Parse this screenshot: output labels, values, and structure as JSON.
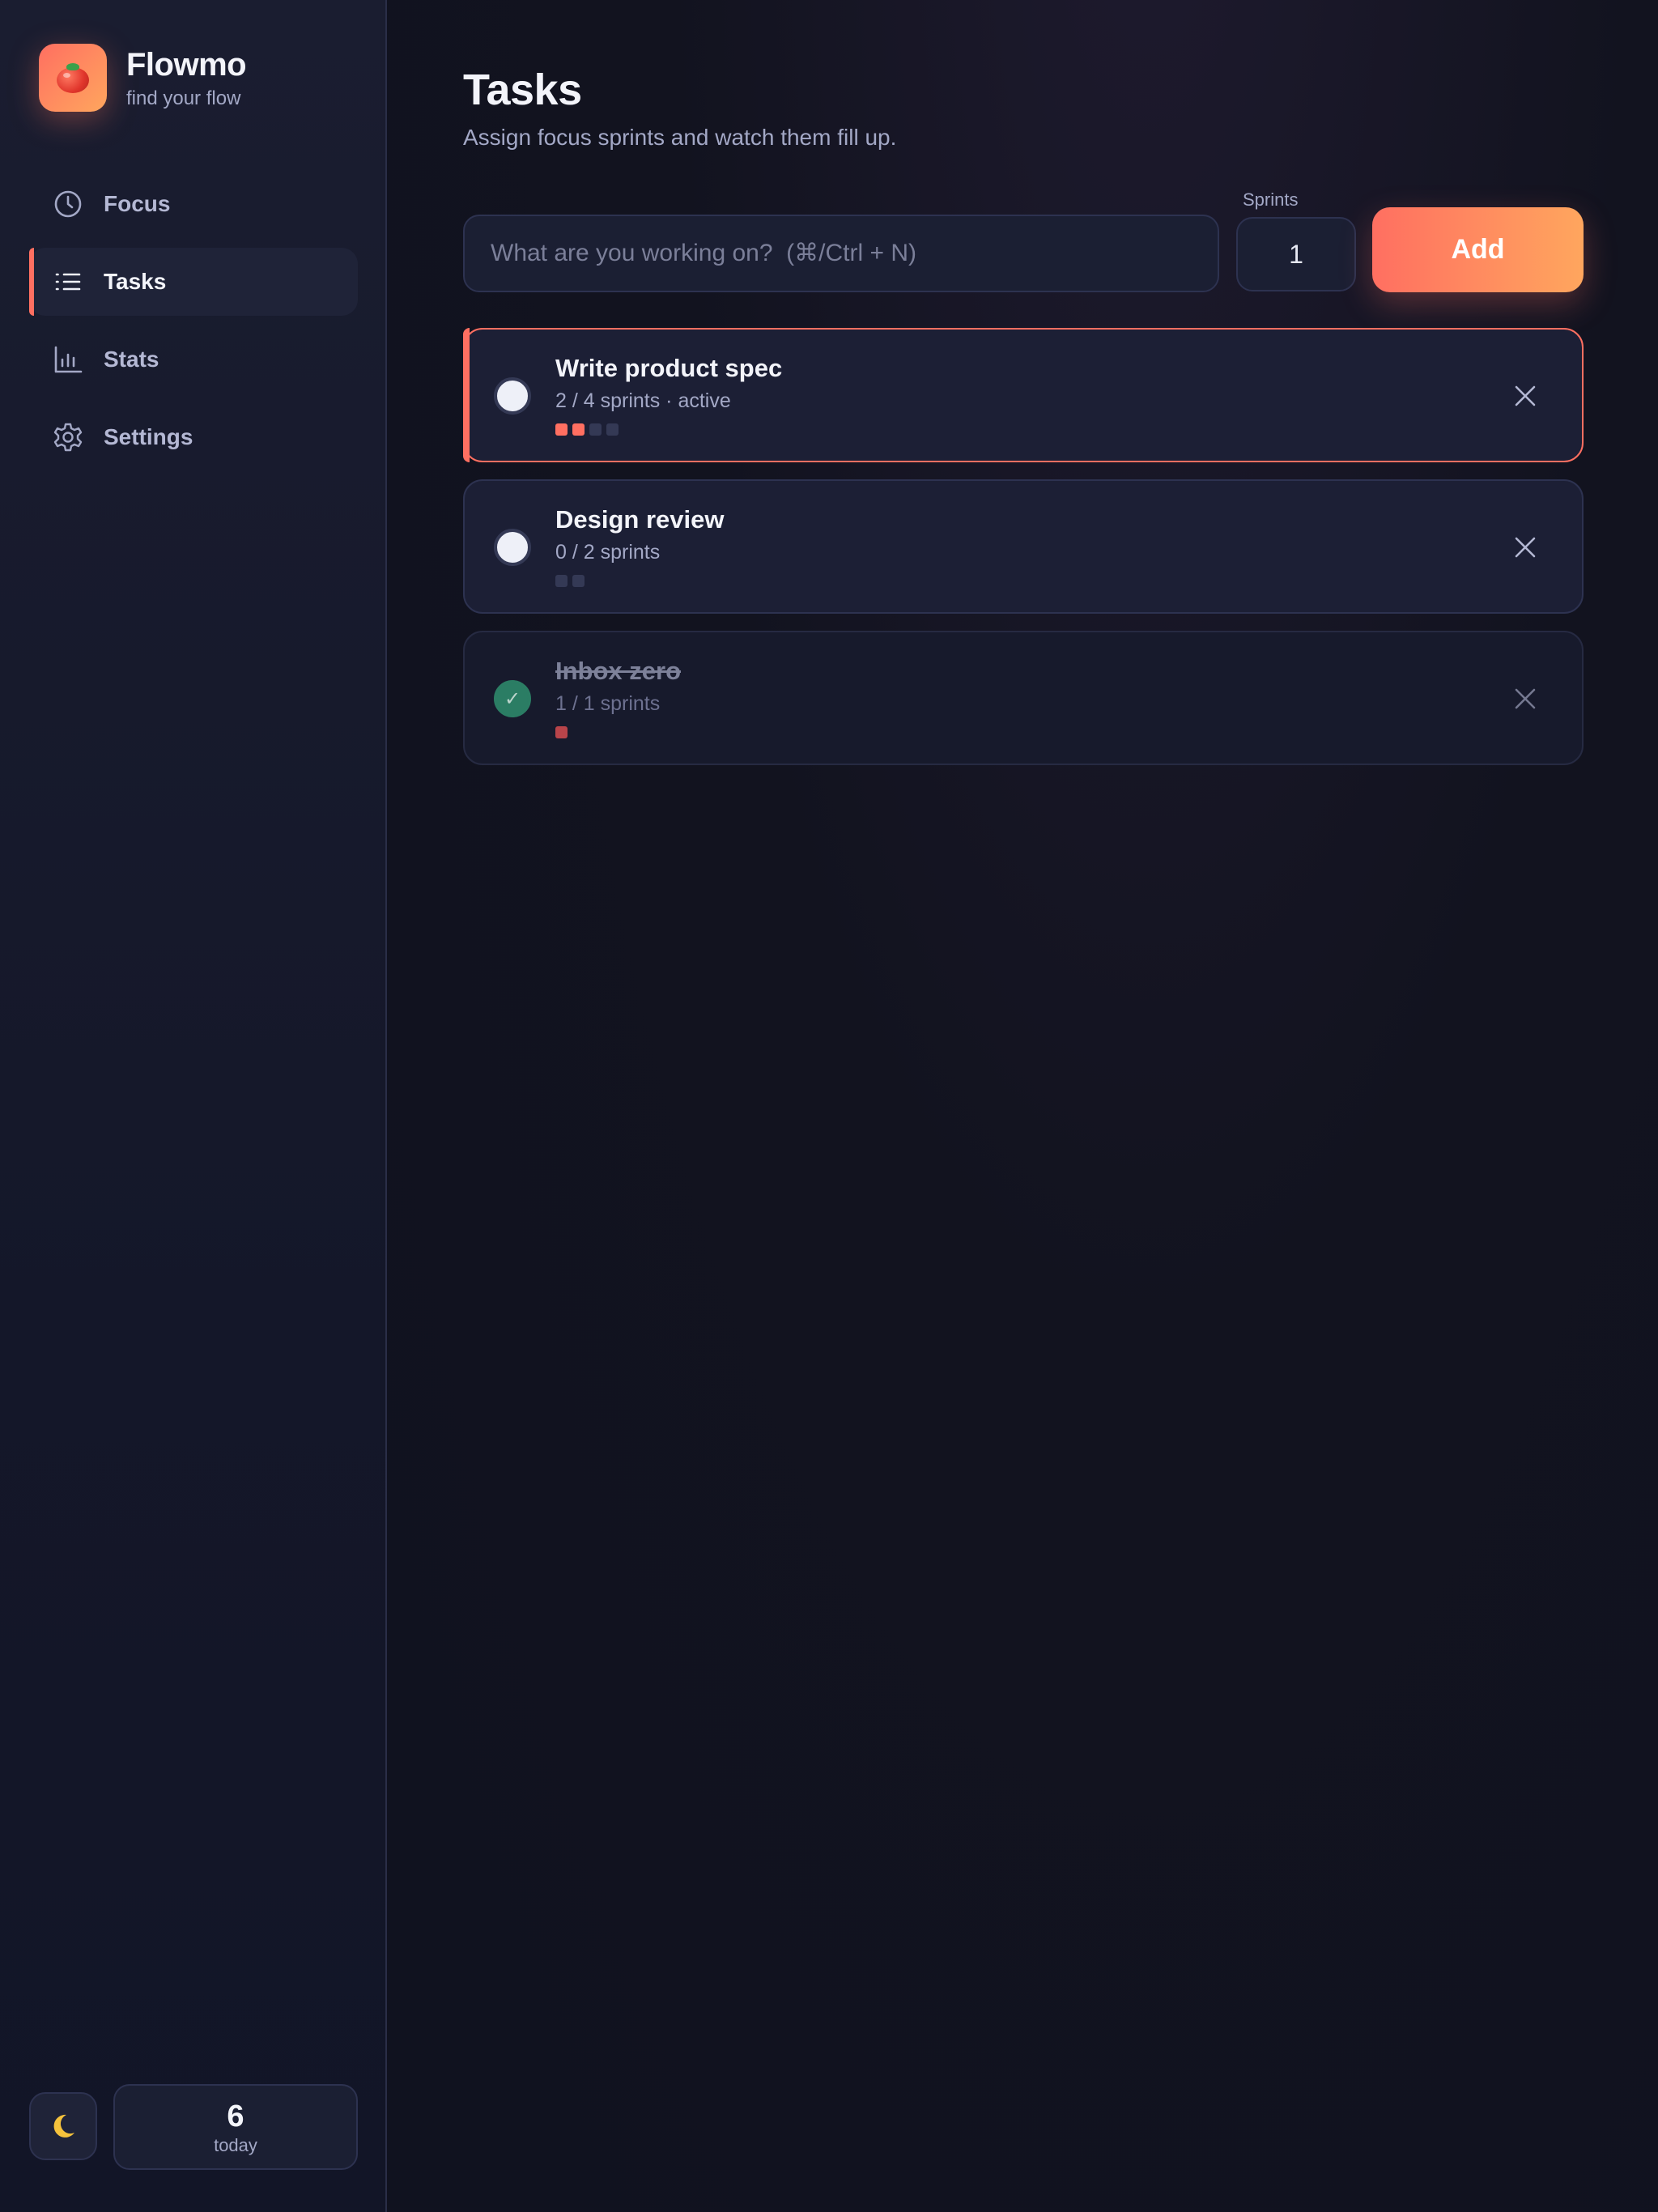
{
  "brand": {
    "name": "Flowmo",
    "tagline": "find your flow"
  },
  "nav": {
    "items": [
      {
        "label": "Focus",
        "icon": "clock-icon",
        "active": false
      },
      {
        "label": "Tasks",
        "icon": "list-icon",
        "active": true
      },
      {
        "label": "Stats",
        "icon": "bar-chart-icon",
        "active": false
      },
      {
        "label": "Settings",
        "icon": "gear-icon",
        "active": false
      }
    ]
  },
  "footer": {
    "theme_icon": "moon-icon",
    "today_count": "6",
    "today_label": "today"
  },
  "page": {
    "title": "Tasks",
    "subtitle": "Assign focus sprints and watch them fill up."
  },
  "form": {
    "task_placeholder": "What are you working on?  (⌘/Ctrl + N)",
    "task_value": "",
    "sprints_label": "Sprints",
    "sprints_value": "1",
    "add_label": "Add"
  },
  "tasks": [
    {
      "title": "Write product spec",
      "meta": "2 / 4 sprints · active",
      "completed_sprints": 2,
      "total_sprints": 4,
      "state": "active"
    },
    {
      "title": "Design review",
      "meta": "0 / 2 sprints",
      "completed_sprints": 0,
      "total_sprints": 2,
      "state": "pending"
    },
    {
      "title": "Inbox zero",
      "meta": "1 / 1 sprints",
      "completed_sprints": 1,
      "total_sprints": 1,
      "state": "done"
    }
  ],
  "colors": {
    "accent": "#ff6f61",
    "accent_end": "#ffa65e",
    "done_green": "#2f8f6e"
  }
}
